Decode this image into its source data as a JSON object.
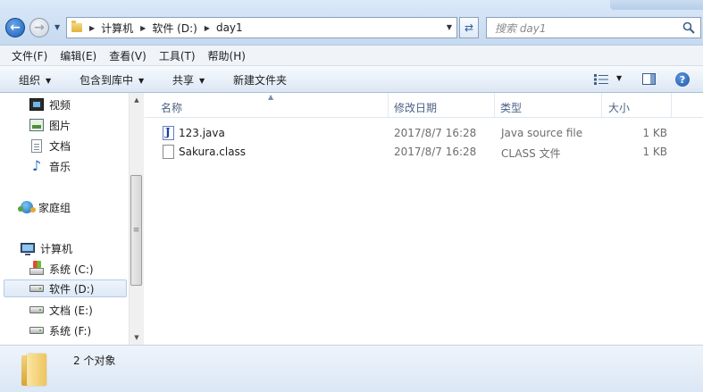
{
  "address": {
    "path": [
      "计算机",
      "软件 (D:)",
      "day1"
    ],
    "search_placeholder": "搜索 day1"
  },
  "menu": [
    "文件(F)",
    "编辑(E)",
    "查看(V)",
    "工具(T)",
    "帮助(H)"
  ],
  "toolbar": {
    "organize": "组织",
    "include_library": "包含到库中",
    "share": "共享",
    "new_folder": "新建文件夹"
  },
  "nav": {
    "libraries": [
      "视频",
      "图片",
      "文档",
      "音乐"
    ],
    "homegroup": "家庭组",
    "computer": "计算机",
    "drives": [
      "系统 (C:)",
      "软件 (D:)",
      "文档 (E:)",
      "系统 (F:)"
    ],
    "selected_drive": "软件 (D:)"
  },
  "columns": {
    "name": "名称",
    "modified": "修改日期",
    "type": "类型",
    "size": "大小"
  },
  "files": [
    {
      "name": "123.java",
      "modified": "2017/8/7 16:28",
      "type": "Java source file",
      "size": "1 KB",
      "icon": "java-file-icon"
    },
    {
      "name": "Sakura.class",
      "modified": "2017/8/7 16:28",
      "type": "CLASS 文件",
      "size": "1 KB",
      "icon": "generic-file-icon"
    }
  ],
  "status": {
    "count_text": "2 个对象"
  }
}
